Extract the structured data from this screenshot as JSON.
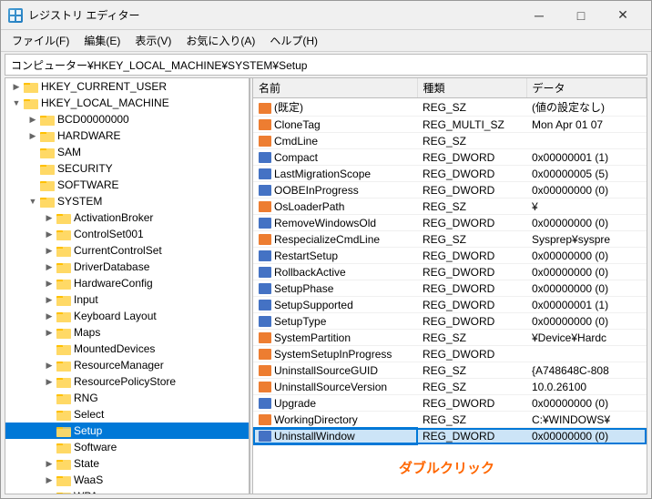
{
  "window": {
    "title": "レジストリ エディター",
    "icon": "registry-icon"
  },
  "titlebar": {
    "minimize": "─",
    "maximize": "□",
    "close": "✕"
  },
  "menubar": {
    "items": [
      {
        "label": "ファイル(F)"
      },
      {
        "label": "編集(E)"
      },
      {
        "label": "表示(V)"
      },
      {
        "label": "お気に入り(A)"
      },
      {
        "label": "ヘルプ(H)"
      }
    ]
  },
  "breadcrumb": "コンピューター¥HKEY_LOCAL_MACHINE¥SYSTEM¥Setup",
  "tree": {
    "items": [
      {
        "label": "HKEY_CURRENT_USER",
        "level": 0,
        "expanded": false,
        "hasChildren": true
      },
      {
        "label": "HKEY_LOCAL_MACHINE",
        "level": 0,
        "expanded": true,
        "hasChildren": true
      },
      {
        "label": "BCD00000000",
        "level": 1,
        "expanded": false,
        "hasChildren": true
      },
      {
        "label": "HARDWARE",
        "level": 1,
        "expanded": false,
        "hasChildren": true
      },
      {
        "label": "SAM",
        "level": 1,
        "expanded": false,
        "hasChildren": false
      },
      {
        "label": "SECURITY",
        "level": 1,
        "expanded": false,
        "hasChildren": false
      },
      {
        "label": "SOFTWARE",
        "level": 1,
        "expanded": false,
        "hasChildren": false
      },
      {
        "label": "SYSTEM",
        "level": 1,
        "expanded": true,
        "hasChildren": true
      },
      {
        "label": "ActivationBroker",
        "level": 2,
        "expanded": false,
        "hasChildren": true
      },
      {
        "label": "ControlSet001",
        "level": 2,
        "expanded": false,
        "hasChildren": true
      },
      {
        "label": "CurrentControlSet",
        "level": 2,
        "expanded": false,
        "hasChildren": true
      },
      {
        "label": "DriverDatabase",
        "level": 2,
        "expanded": false,
        "hasChildren": true
      },
      {
        "label": "HardwareConfig",
        "level": 2,
        "expanded": false,
        "hasChildren": true
      },
      {
        "label": "Input",
        "level": 2,
        "expanded": false,
        "hasChildren": true
      },
      {
        "label": "Keyboard Layout",
        "level": 2,
        "expanded": false,
        "hasChildren": true
      },
      {
        "label": "Maps",
        "level": 2,
        "expanded": false,
        "hasChildren": true
      },
      {
        "label": "MountedDevices",
        "level": 2,
        "expanded": false,
        "hasChildren": false
      },
      {
        "label": "ResourceManager",
        "level": 2,
        "expanded": false,
        "hasChildren": true
      },
      {
        "label": "ResourcePolicyStore",
        "level": 2,
        "expanded": false,
        "hasChildren": true
      },
      {
        "label": "RNG",
        "level": 2,
        "expanded": false,
        "hasChildren": false
      },
      {
        "label": "Select",
        "level": 2,
        "expanded": false,
        "hasChildren": false
      },
      {
        "label": "Setup",
        "level": 2,
        "expanded": false,
        "hasChildren": false,
        "selected": true
      },
      {
        "label": "Software",
        "level": 2,
        "expanded": false,
        "hasChildren": false
      },
      {
        "label": "State",
        "level": 2,
        "expanded": false,
        "hasChildren": true
      },
      {
        "label": "WaaS",
        "level": 2,
        "expanded": false,
        "hasChildren": true
      },
      {
        "label": "WPA",
        "level": 2,
        "expanded": false,
        "hasChildren": true
      }
    ]
  },
  "registry": {
    "columns": [
      "名前",
      "種類",
      "データ"
    ],
    "rows": [
      {
        "icon": "sz",
        "name": "(既定)",
        "type": "REG_SZ",
        "data": "(値の設定なし)"
      },
      {
        "icon": "sz",
        "name": "CloneTag",
        "type": "REG_MULTI_SZ",
        "data": "Mon Apr 01 07"
      },
      {
        "icon": "sz",
        "name": "CmdLine",
        "type": "REG_SZ",
        "data": ""
      },
      {
        "icon": "dword",
        "name": "Compact",
        "type": "REG_DWORD",
        "data": "0x00000001 (1)"
      },
      {
        "icon": "dword",
        "name": "LastMigrationScope",
        "type": "REG_DWORD",
        "data": "0x00000005 (5)"
      },
      {
        "icon": "dword",
        "name": "OOBEInProgress",
        "type": "REG_DWORD",
        "data": "0x00000000 (0)"
      },
      {
        "icon": "sz",
        "name": "OsLoaderPath",
        "type": "REG_SZ",
        "data": "¥"
      },
      {
        "icon": "dword",
        "name": "RemoveWindowsOld",
        "type": "REG_DWORD",
        "data": "0x00000000 (0)"
      },
      {
        "icon": "sz",
        "name": "RespecializeCmdLine",
        "type": "REG_SZ",
        "data": "Sysprep¥syspre"
      },
      {
        "icon": "dword",
        "name": "RestartSetup",
        "type": "REG_DWORD",
        "data": "0x00000000 (0)"
      },
      {
        "icon": "dword",
        "name": "RollbackActive",
        "type": "REG_DWORD",
        "data": "0x00000000 (0)"
      },
      {
        "icon": "dword",
        "name": "SetupPhase",
        "type": "REG_DWORD",
        "data": "0x00000000 (0)"
      },
      {
        "icon": "dword",
        "name": "SetupSupported",
        "type": "REG_DWORD",
        "data": "0x00000001 (1)"
      },
      {
        "icon": "dword",
        "name": "SetupType",
        "type": "REG_DWORD",
        "data": "0x00000000 (0)"
      },
      {
        "icon": "sz",
        "name": "SystemPartition",
        "type": "REG_SZ",
        "data": "¥Device¥Hardc"
      },
      {
        "icon": "sz",
        "name": "SystemSetupInProgress",
        "type": "REG_DWORD",
        "data": ""
      },
      {
        "icon": "sz",
        "name": "UninstallSourceGUID",
        "type": "REG_SZ",
        "data": "{A748648C-808"
      },
      {
        "icon": "sz",
        "name": "UninstallSourceVersion",
        "type": "REG_SZ",
        "data": "10.0.26100"
      },
      {
        "icon": "dword",
        "name": "Upgrade",
        "type": "REG_DWORD",
        "data": "0x00000000 (0)"
      },
      {
        "icon": "sz",
        "name": "WorkingDirectory",
        "type": "REG_SZ",
        "data": "C:¥WINDOWS¥"
      },
      {
        "icon": "dword",
        "name": "UninstallWindow",
        "type": "REG_DWORD",
        "data": "0x00000000 (0)",
        "highlighted": true
      }
    ]
  },
  "tooltip": {
    "label": "ダブルクリック"
  },
  "statusbar": {
    "text": ""
  }
}
